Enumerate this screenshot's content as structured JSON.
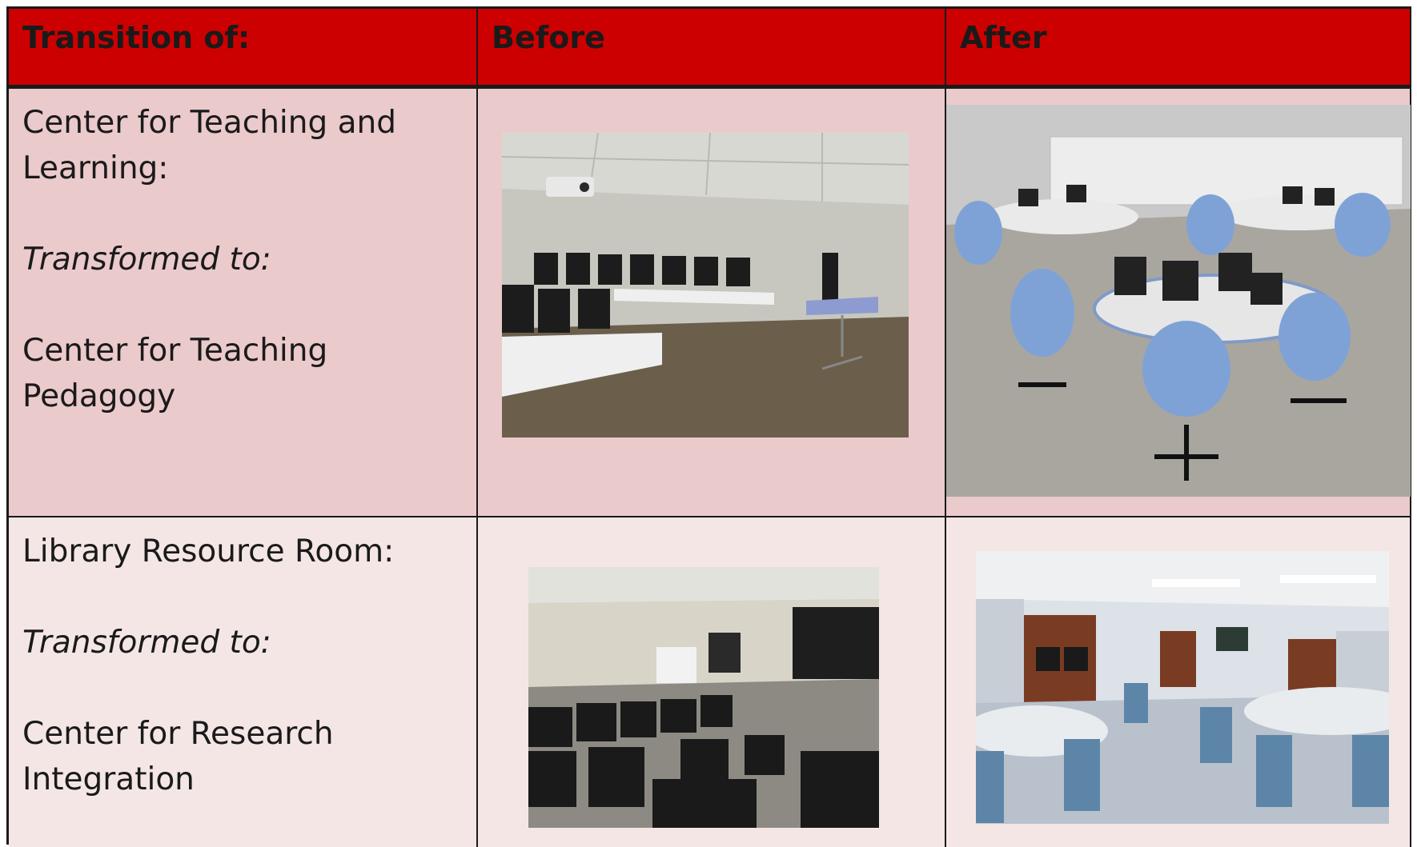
{
  "table": {
    "headers": [
      "Transition of:",
      "Before",
      "After"
    ],
    "rows": [
      {
        "from": "Center for Teaching and Learning:",
        "transformed_label": "Transformed to:",
        "to": "Center for Teaching Pedagogy",
        "before_image": "computer-lab-classroom-photo",
        "after_image": "collaborative-classroom-photo"
      },
      {
        "from": "Library Resource Room:",
        "transformed_label": "Transformed to:",
        "to": "Center for Research Integration",
        "before_image": "computer-lab-rows-photo",
        "after_image": "research-collaboration-room-photo"
      }
    ]
  },
  "colors": {
    "header_bg": "#cc0000",
    "row1_bg": "#ebcacc",
    "row2_bg": "#f5e6e6",
    "border": "#1a1a1a"
  }
}
